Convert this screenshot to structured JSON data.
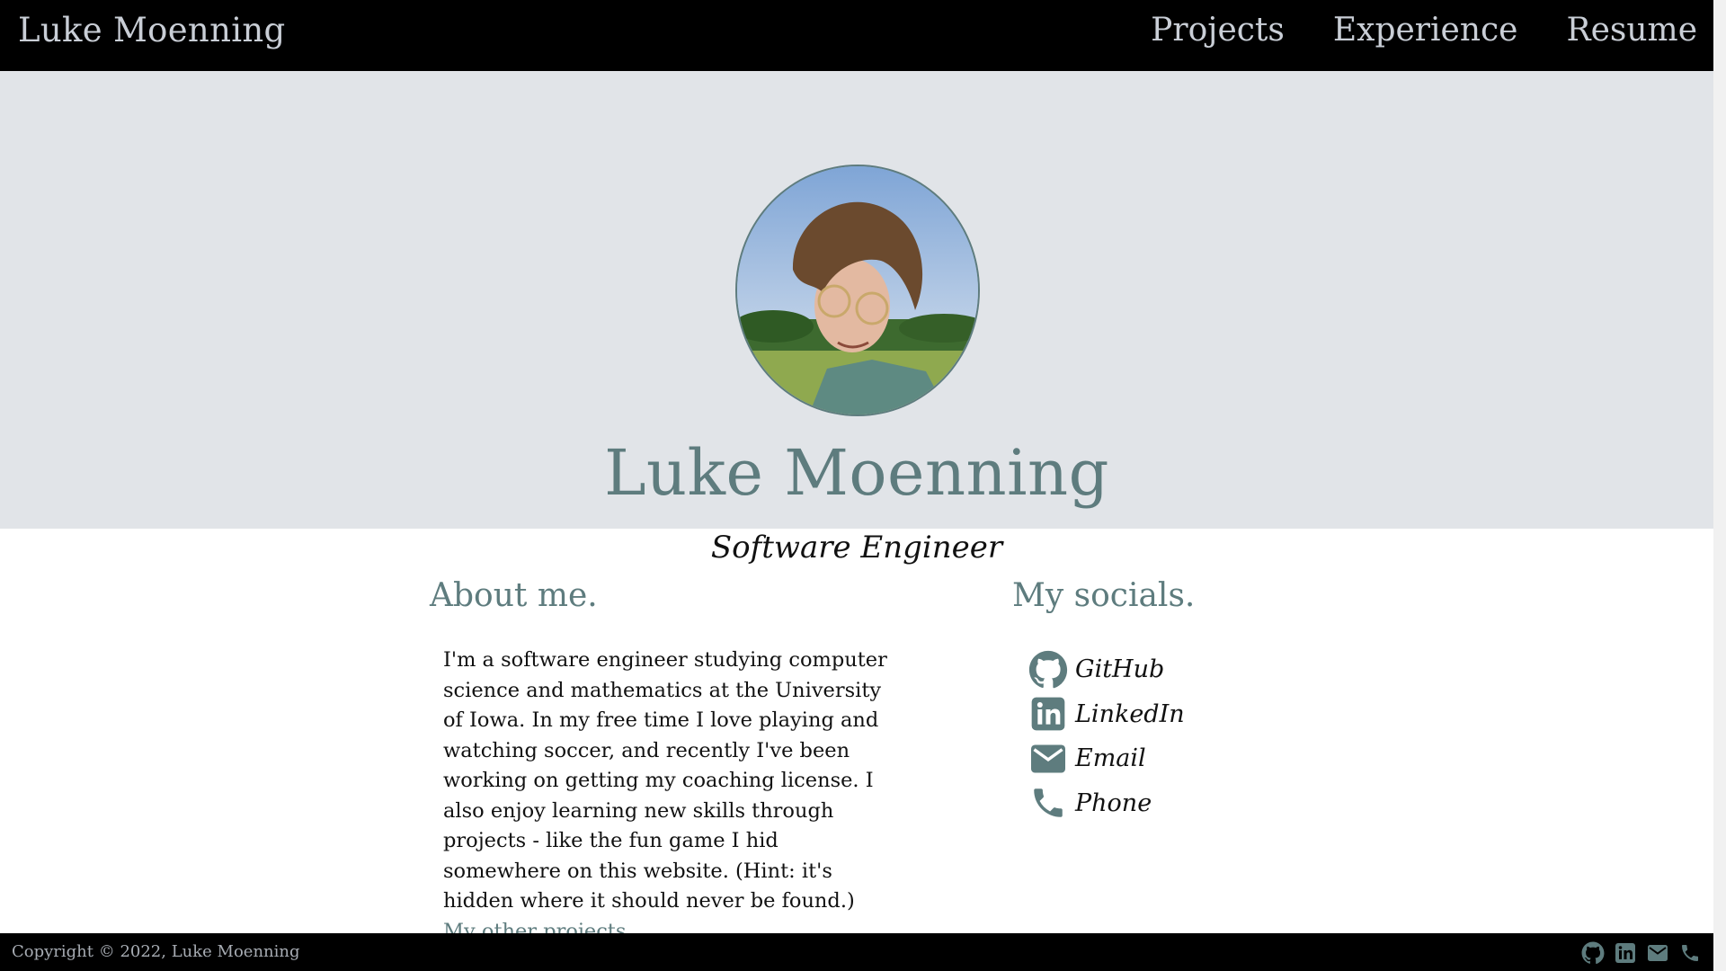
{
  "header": {
    "brand": "Luke Moenning",
    "nav": [
      {
        "label": "Projects"
      },
      {
        "label": "Experience"
      },
      {
        "label": "Resume"
      }
    ]
  },
  "hero": {
    "name": "Luke Moenning",
    "title": "Software Engineer"
  },
  "about": {
    "heading": "About me.",
    "text": "I'm a software engineer studying computer science and mathematics at the University of Iowa. In my free time I love playing and watching soccer, and recently I've been working on getting my coaching license. I also enjoy learning new skills through projects - like the fun game I hid somewhere on this website. (Hint: it's hidden where it should never be found.)",
    "link": "My other projects."
  },
  "socials": {
    "heading": "My socials.",
    "items": [
      {
        "label": "GitHub",
        "icon": "github-icon"
      },
      {
        "label": "LinkedIn",
        "icon": "linkedin-icon"
      },
      {
        "label": "Email",
        "icon": "email-icon"
      },
      {
        "label": "Phone",
        "icon": "phone-icon"
      }
    ]
  },
  "footer": {
    "copyright": "Copyright © 2022, Luke Moenning",
    "icons": [
      "github-icon",
      "linkedin-icon",
      "email-icon",
      "phone-icon"
    ]
  },
  "colors": {
    "accent": "#5e7c7e",
    "header_bg": "#000000",
    "hero_bg": "#e1e4e8",
    "nav_text": "#c9ced6"
  }
}
